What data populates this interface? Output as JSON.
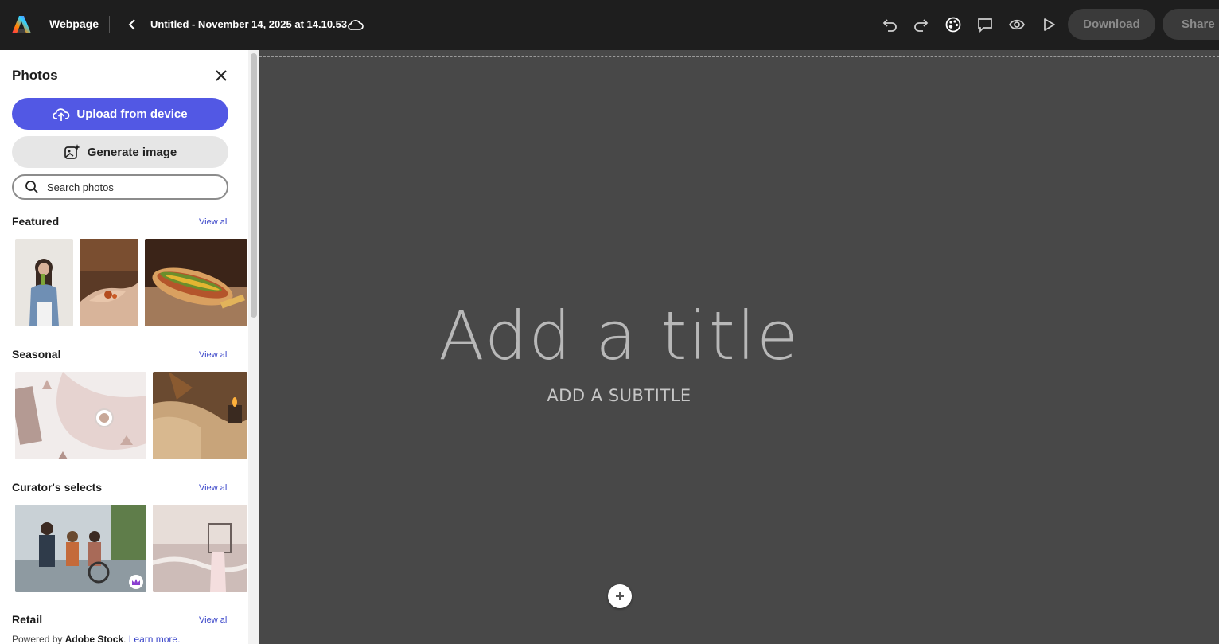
{
  "header": {
    "app_name": "Webpage",
    "doc_title": "Untitled - November 14, 2025 at 14.10.53",
    "download_label": "Download",
    "share_label": "Share"
  },
  "panel": {
    "title": "Photos",
    "upload_label": "Upload from device",
    "generate_label": "Generate image",
    "search_placeholder": "Search photos",
    "sections": [
      {
        "title": "Featured",
        "view_all": "View all"
      },
      {
        "title": "Seasonal",
        "view_all": "View all"
      },
      {
        "title": "Curator's selects",
        "view_all": "View all"
      },
      {
        "title": "Retail",
        "view_all": "View all"
      }
    ],
    "footer": {
      "prefix": "Powered by ",
      "brand": "Adobe Stock",
      "suffix": ". ",
      "link": "Learn more."
    }
  },
  "canvas": {
    "title": "Add a title",
    "subtitle": "ADD A SUBTITLE"
  },
  "colors": {
    "accent": "#5258e4",
    "topbar": "#1e1e1e",
    "canvas": "#484848"
  }
}
